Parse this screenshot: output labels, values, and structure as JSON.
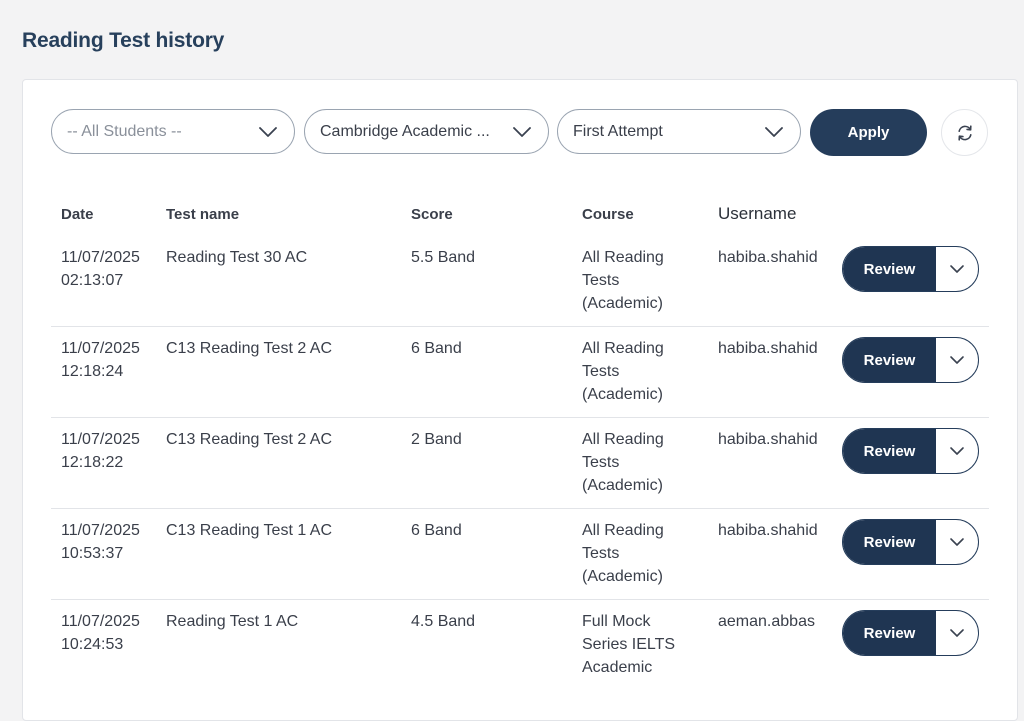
{
  "page": {
    "title": "Reading Test history"
  },
  "filters": {
    "student": "-- All Students --",
    "course": "Cambridge Academic ...",
    "attempt": "First Attempt",
    "apply_label": "Apply"
  },
  "table": {
    "headers": {
      "date": "Date",
      "test_name": "Test name",
      "score": "Score",
      "course": "Course",
      "username": "Username"
    },
    "review_label": "Review",
    "rows": [
      {
        "date": "11/07/2025",
        "time": "02:13:07",
        "test_name": "Reading Test 30 AC",
        "score": "5.5 Band",
        "course": [
          "All Reading",
          "Tests",
          "(Academic)"
        ],
        "username": "habiba.shahid"
      },
      {
        "date": "11/07/2025",
        "time": "12:18:24",
        "test_name": "C13 Reading Test 2 AC",
        "score": "6 Band",
        "course": [
          "All Reading",
          "Tests",
          "(Academic)"
        ],
        "username": "habiba.shahid"
      },
      {
        "date": "11/07/2025",
        "time": "12:18:22",
        "test_name": "C13 Reading Test 2 AC",
        "score": "2 Band",
        "course": [
          "All Reading",
          "Tests",
          "(Academic)"
        ],
        "username": "habiba.shahid"
      },
      {
        "date": "11/07/2025",
        "time": "10:53:37",
        "test_name": "C13 Reading Test 1 AC",
        "score": "6 Band",
        "course": [
          "All Reading",
          "Tests",
          "(Academic)"
        ],
        "username": "habiba.shahid"
      },
      {
        "date": "11/07/2025",
        "time": "10:24:53",
        "test_name": "Reading Test 1 AC",
        "score": "4.5 Band",
        "course": [
          "Full Mock",
          "Series IELTS",
          "Academic"
        ],
        "username": "aeman.abbas"
      }
    ]
  },
  "icons": {
    "dropdown": "chevron-down-icon",
    "refresh": "refresh-icon"
  },
  "colors": {
    "primary": "#253d5b",
    "title": "#27405c"
  }
}
